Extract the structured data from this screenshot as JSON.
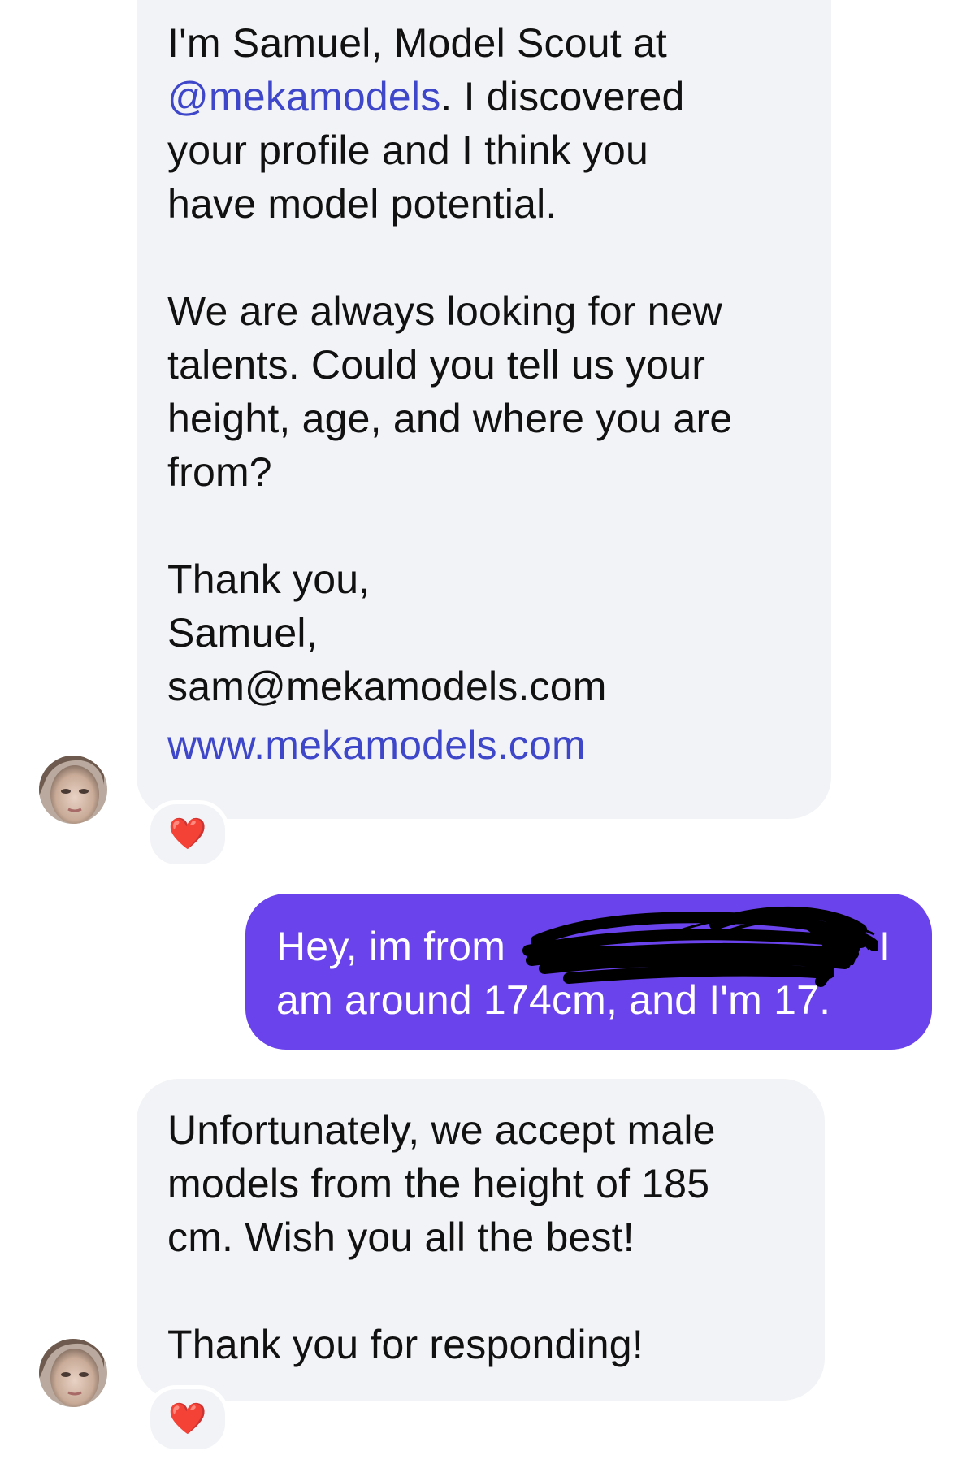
{
  "messages": [
    {
      "sender": "incoming",
      "paragraphs": [
        {
          "lines": [
            [
              {
                "text": "I'm Samuel, Model Scout at"
              }
            ],
            [
              {
                "text": "@mekamodels",
                "link": true
              },
              {
                "text": ". I discovered"
              }
            ],
            [
              {
                "text": "your profile and I think you"
              }
            ],
            [
              {
                "text": "have model potential."
              }
            ]
          ]
        },
        {
          "lines": [
            [
              {
                "text": "We are always looking for new"
              }
            ],
            [
              {
                "text": "talents. Could you tell us your"
              }
            ],
            [
              {
                "text": "height, age, and where you are"
              }
            ],
            [
              {
                "text": "from?"
              }
            ]
          ]
        },
        {
          "lines": [
            [
              {
                "text": "Thank you,"
              }
            ],
            [
              {
                "text": "Samuel,"
              }
            ],
            [
              {
                "text": "sam@mekamodels.com"
              }
            ],
            [
              {
                "text": "www.mekamodels.com",
                "link": true
              }
            ]
          ]
        }
      ],
      "reaction": "❤️"
    },
    {
      "sender": "outgoing",
      "lines": [
        "Hey, im from [redacted], I",
        "am around 174cm, and I'm 17."
      ],
      "visible_lines": [
        "Hey, im from",
        "am around 174cm, and I'm 17."
      ],
      "partial_trailing_text": "I"
    },
    {
      "sender": "incoming",
      "paragraphs": [
        {
          "lines": [
            [
              {
                "text": "Unfortunately, we accept male"
              }
            ],
            [
              {
                "text": "models from the height of 185"
              }
            ],
            [
              {
                "text": "cm. Wish you all the best!"
              }
            ]
          ]
        },
        {
          "lines": [
            [
              {
                "text": "Thank you for responding!"
              }
            ]
          ]
        }
      ],
      "reaction": "❤️"
    }
  ],
  "colors": {
    "incoming_bubble": "#f2f3f6",
    "outgoing_bubble": "#6a43ec",
    "link": "#3e46c9",
    "reaction_heart": "#e0245e"
  },
  "icons": {
    "avatar": "profile-photo-avatar",
    "reaction": "red-heart-icon"
  }
}
